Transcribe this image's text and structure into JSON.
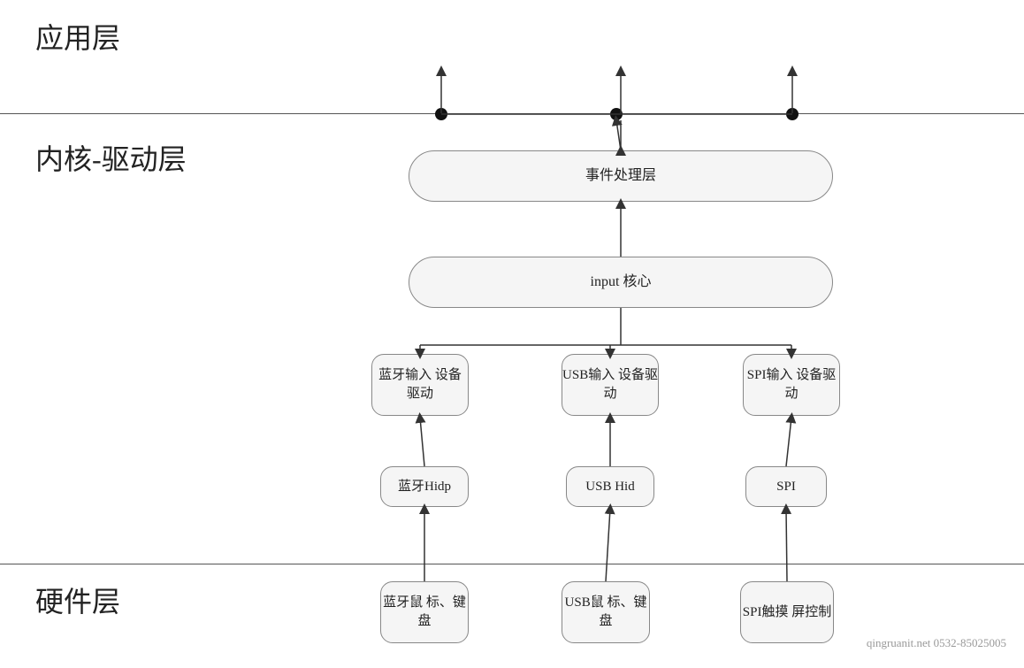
{
  "layers": {
    "app_label": "应用层",
    "kernel_label": "内核-驱动层",
    "hardware_label": "硬件层"
  },
  "boxes": {
    "event_handler": "事件处理层",
    "input_core": "input 核心",
    "bt_driver": "蓝牙输入\n设备驱动",
    "usb_driver": "USB输入\n设备驱动",
    "spi_driver": "SPI输入\n设备驱动",
    "bt_hidp": "蓝牙Hidp",
    "usb_hid": "USB Hid",
    "spi": "SPI",
    "bt_hardware": "蓝牙鼠\n标、键盘",
    "usb_hardware": "USB鼠\n标、键盘",
    "spi_hardware": "SPI触摸\n屏控制"
  },
  "watermark": "qingruanit.net 0532-85025005"
}
